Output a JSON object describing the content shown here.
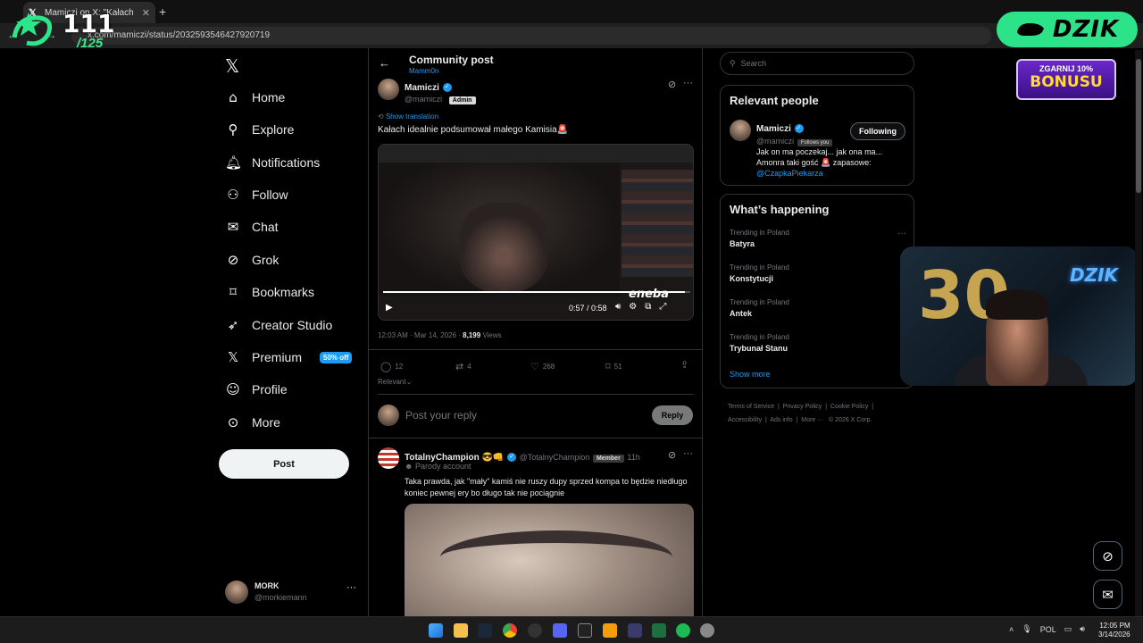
{
  "browser": {
    "tab_title": "Mamiczi on X: \"Kałach idealnie...",
    "url": "x.com/mamiczi/status/2032593546427920719"
  },
  "overlay": {
    "counter_big": "111",
    "counter_small": "/125",
    "dzik_brand": "DZIK",
    "bonus_line1": "ZGARNIJ 10%",
    "bonus_line2": "BONUSU",
    "webcam_neon": "DZIK",
    "webcam_balloon": "30"
  },
  "nav": {
    "items": [
      {
        "label": "Home",
        "icon": "home-icon"
      },
      {
        "label": "Explore",
        "icon": "search-icon"
      },
      {
        "label": "Notifications",
        "icon": "bell-icon"
      },
      {
        "label": "Follow",
        "icon": "person-add-icon"
      },
      {
        "label": "Chat",
        "icon": "mail-icon"
      },
      {
        "label": "Grok",
        "icon": "grok-icon"
      },
      {
        "label": "Bookmarks",
        "icon": "bookmark-icon"
      },
      {
        "label": "Creator Studio",
        "icon": "rocket-icon"
      },
      {
        "label": "Premium",
        "icon": "x-icon"
      },
      {
        "label": "Profile",
        "icon": "profile-icon"
      },
      {
        "label": "More",
        "icon": "more-circle-icon"
      }
    ],
    "premium_badge": "50% off",
    "post_button": "Post",
    "account_name": "MORK",
    "account_handle": "@morkiemann"
  },
  "header": {
    "title": "Community post",
    "subtitle": "Mamm0n"
  },
  "post": {
    "author_name": "Mamiczi",
    "author_handle": "@mamiczi",
    "role_badge": "Admin",
    "show_translation": "Show translation",
    "text": "Kałach idealnie podsumował małego Kamisia🚨",
    "video_time": "0:57 / 0:58",
    "video_progress": 0.983,
    "watermark": "eneba",
    "timestamp": "12:03 AM · Mar 14, 2026 · ",
    "views_count": "8,199",
    "views_label": "Views",
    "replies": "12",
    "reposts": "4",
    "likes": "268",
    "bookmarks": "51",
    "sort_label": "Relevant"
  },
  "reply_box": {
    "placeholder": "Post your reply",
    "button": "Reply"
  },
  "reply": {
    "author_name": "TotalnyChampion 😎👊",
    "author_handle": "@TotalnyChampion",
    "role_badge": "Member",
    "age": "11h",
    "parody": "Parody account",
    "text": "Taka prawda, jak \"mały\" kamiś nie ruszy dupy sprzed kompa to będzie niedługo koniec pewnej ery bo długo tak nie pociągnie"
  },
  "sidebar": {
    "search_placeholder": "Search",
    "relevant_title": "Relevant people",
    "person_name": "Mamiczi",
    "person_handle": "@mamiczi",
    "follows_you": "Follows you",
    "follow_button": "Following",
    "bio": "Jak on ma poczekaj... jak ona ma... Amonra taki gość 🚨 zapasowe:",
    "bio_link": "@CzapkaPiekarza",
    "happening_title": "What’s happening",
    "trends": [
      {
        "label": "Trending in Poland",
        "title": "Batyra"
      },
      {
        "label": "Trending in Poland",
        "title": "Konstytucji"
      },
      {
        "label": "Trending in Poland",
        "title": "Antek"
      },
      {
        "label": "Trending in Poland",
        "title": "Trybunał Stanu"
      }
    ],
    "show_more": "Show more",
    "footer": [
      "Terms of Service",
      "Privacy Policy",
      "Cookie Policy",
      "Accessibility",
      "Ads info",
      "More ···",
      "© 2026 X Corp."
    ]
  },
  "taskbar": {
    "lang": "POL",
    "time": "12:05 PM",
    "date": "3/14/2026"
  }
}
